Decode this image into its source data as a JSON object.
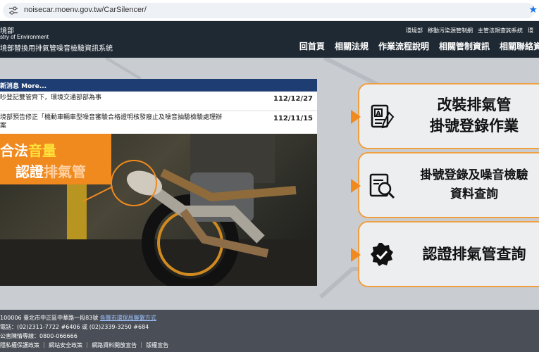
{
  "browser": {
    "url": "noisecar.moenv.gov.tw/CarSilencer/"
  },
  "header": {
    "logo_cn": "境部",
    "logo_en": "stry of Environment",
    "site_title": "境部替換用排氣管噪音檢驗資訊系統",
    "top_links": [
      "環境部",
      "移動污染源管制網",
      "主管法規查詢系統",
      "環"
    ],
    "nav": [
      "回首頁",
      "相關法規",
      "作業流程說明",
      "相關管制資訊",
      "相關聯絡資"
    ]
  },
  "news": {
    "header": "新消息 More...",
    "items": [
      {
        "title": "吵登記雙管齊下，環境交通部部為事",
        "date": "112/12/27"
      },
      {
        "title": "境部預告修正「機動車輛車型噪音審驗合格證明核發廢止及噪音抽驗檢驗處理辦",
        "title2": "案",
        "date": "112/11/15"
      }
    ]
  },
  "banner": {
    "line1_a": "合法",
    "line1_b": "音量",
    "line2_a": "認證",
    "line2_b": "排氣管"
  },
  "cards": [
    {
      "line1": "改裝排氣管",
      "line2": "掛號登錄作業",
      "icon": "form-icon"
    },
    {
      "line1": "掛號登錄及噪音檢驗",
      "line2": "資料查詢",
      "icon": "search-document-icon"
    },
    {
      "line1": "認證排氣管查詢",
      "line2": "",
      "icon": "verified-badge-icon"
    }
  ],
  "footer": {
    "address": "100006 臺北市中正區中華路一段83號",
    "address_link": "各縣市環保局聯繫方式",
    "phone": "電話：(02)2311-7722 #6406 或 (02)2339-3250 #684",
    "hotline": "公害陳情專線：0800-066666",
    "links": [
      "隱私權保護政策",
      "網站安全政策",
      "網路資料開放宣告",
      "版權宣告"
    ]
  },
  "colors": {
    "header_bg": "#1f2933",
    "accent": "#f0891e",
    "news_head": "#1e3d73"
  }
}
